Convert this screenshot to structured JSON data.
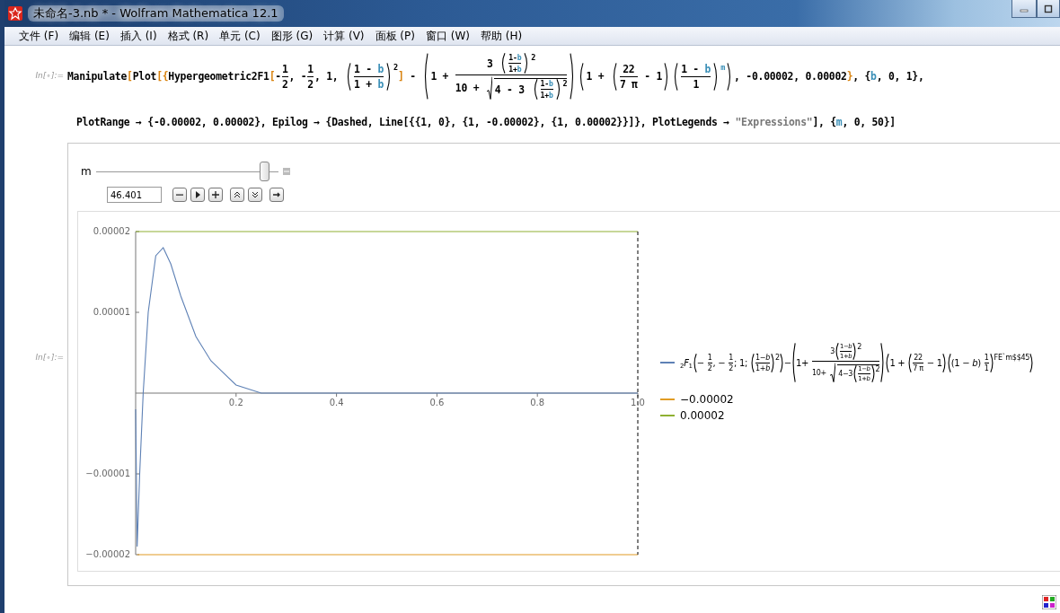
{
  "window": {
    "title": "未命名-3.nb * - Wolfram Mathematica 12.1"
  },
  "menu": [
    "文件 (F)",
    "编辑 (E)",
    "插入 (I)",
    "格式 (R)",
    "单元 (C)",
    "图形 (G)",
    "计算 (V)",
    "面板 (P)",
    "窗口 (W)",
    "帮助 (H)"
  ],
  "input_cell": {
    "label": "In[∘]:=",
    "lines": [
      [
        {
          "kind": "t",
          "text": "Manipulate"
        },
        {
          "kind": "br",
          "text": "["
        },
        {
          "kind": "t",
          "text": "Plot"
        },
        {
          "kind": "br",
          "text": "["
        },
        {
          "kind": "br",
          "text": "{"
        },
        {
          "kind": "t",
          "text": "Hypergeometric2F1"
        },
        {
          "kind": "br",
          "text": "["
        },
        {
          "kind": "t",
          "text": "-"
        },
        {
          "kind": "frac",
          "num": [
            {
              "kind": "t",
              "text": "1"
            }
          ],
          "den": [
            {
              "kind": "t",
              "text": "2"
            }
          ]
        },
        {
          "kind": "t",
          "text": ", -"
        },
        {
          "kind": "frac",
          "num": [
            {
              "kind": "t",
              "text": "1"
            }
          ],
          "den": [
            {
              "kind": "t",
              "text": "2"
            }
          ]
        },
        {
          "kind": "t",
          "text": ", 1, "
        },
        {
          "kind": "paren",
          "body": [
            {
              "kind": "frac",
              "num": [
                {
                  "kind": "t",
                  "text": "1 - "
                },
                {
                  "kind": "var",
                  "text": "b"
                }
              ],
              "den": [
                {
                  "kind": "t",
                  "text": "1 + "
                },
                {
                  "kind": "var",
                  "text": "b"
                }
              ]
            }
          ],
          "sup": [
            {
              "kind": "t",
              "text": "2"
            }
          ]
        },
        {
          "kind": "br",
          "text": "]"
        },
        {
          "kind": "t",
          "text": " - "
        },
        {
          "kind": "paren",
          "body": [
            {
              "kind": "t",
              "text": "1 + "
            },
            {
              "kind": "frac",
              "num": [
                {
                  "kind": "t",
                  "text": "3 "
                },
                {
                  "kind": "paren",
                  "body": [
                    {
                      "kind": "frac",
                      "num": [
                        {
                          "kind": "t",
                          "text": "1-"
                        },
                        {
                          "kind": "var",
                          "text": "b"
                        }
                      ],
                      "den": [
                        {
                          "kind": "t",
                          "text": "1+"
                        },
                        {
                          "kind": "var",
                          "text": "b"
                        }
                      ]
                    }
                  ],
                  "sup": [
                    {
                      "kind": "t",
                      "text": "2"
                    }
                  ]
                }
              ],
              "den": [
                {
                  "kind": "t",
                  "text": "10 + "
                },
                {
                  "kind": "sqrt",
                  "body": [
                    {
                      "kind": "t",
                      "text": "4 - 3 "
                    },
                    {
                      "kind": "paren",
                      "body": [
                        {
                          "kind": "frac",
                          "num": [
                            {
                              "kind": "t",
                              "text": "1-"
                            },
                            {
                              "kind": "var",
                              "text": "b"
                            }
                          ],
                          "den": [
                            {
                              "kind": "t",
                              "text": "1+"
                            },
                            {
                              "kind": "var",
                              "text": "b"
                            }
                          ]
                        }
                      ],
                      "sup": [
                        {
                          "kind": "t",
                          "text": "2"
                        }
                      ]
                    }
                  ]
                }
              ]
            }
          ]
        },
        {
          "kind": "paren",
          "body": [
            {
              "kind": "t",
              "text": "1 + "
            },
            {
              "kind": "paren",
              "body": [
                {
                  "kind": "frac",
                  "num": [
                    {
                      "kind": "t",
                      "text": "22"
                    }
                  ],
                  "den": [
                    {
                      "kind": "t",
                      "text": "7 π"
                    }
                  ]
                },
                {
                  "kind": "t",
                  "text": " - 1"
                }
              ]
            },
            {
              "kind": "paren",
              "body": [
                {
                  "kind": "frac",
                  "num": [
                    {
                      "kind": "t",
                      "text": "1 - "
                    },
                    {
                      "kind": "var",
                      "text": "b"
                    }
                  ],
                  "den": [
                    {
                      "kind": "t",
                      "text": "1"
                    }
                  ]
                }
              ],
              "sup": [
                {
                  "kind": "var",
                  "text": "m"
                }
              ]
            }
          ]
        },
        {
          "kind": "t",
          "text": ", -0.00002, 0.00002"
        },
        {
          "kind": "br",
          "text": "}"
        },
        {
          "kind": "t",
          "text": ", {"
        },
        {
          "kind": "var",
          "text": "b"
        },
        {
          "kind": "t",
          "text": ", 0, 1},"
        }
      ],
      [
        {
          "kind": "t",
          "text": "PlotRange → {-0.00002, 0.00002}, Epilog → {Dashed, Line[{{1, 0}, {1, -0.00002}, {1, 0.00002}}]}, PlotLegends → "
        },
        {
          "kind": "str",
          "text": "\"Expressions\""
        },
        {
          "kind": "t",
          "text": "], {"
        },
        {
          "kind": "var",
          "text": "m"
        },
        {
          "kind": "t",
          "text": ", 0, 50}]"
        }
      ]
    ]
  },
  "output_cell": {
    "label": "In[∘]:=",
    "control": {
      "label": "m",
      "level": 0.928,
      "value": "46.401"
    },
    "chart_data": {
      "type": "line",
      "x": [
        0,
        0.003,
        0.008,
        0.015,
        0.025,
        0.04,
        0.055,
        0.07,
        0.09,
        0.12,
        0.15,
        0.2,
        0.25,
        0.3,
        0.4,
        0.6,
        0.8,
        1.0
      ],
      "series": [
        {
          "color": "#5e81b5",
          "values": [
            -2e-06,
            -1.9e-05,
            -1e-05,
            0,
            1e-05,
            1.7e-05,
            1.8e-05,
            1.6e-05,
            1.2e-05,
            7e-06,
            4e-06,
            1e-06,
            0,
            0,
            0,
            0,
            0,
            0
          ]
        },
        {
          "color": "#e19c24",
          "values": [
            null,
            -2e-05,
            -2e-05,
            -2e-05,
            -2e-05,
            -2e-05,
            -2e-05,
            -2e-05,
            -2e-05,
            -2e-05,
            -2e-05,
            -2e-05,
            -2e-05,
            -2e-05,
            -2e-05,
            -2e-05,
            -2e-05,
            -2e-05
          ]
        },
        {
          "color": "#8fb032",
          "values": [
            2e-05,
            2e-05,
            2e-05,
            2e-05,
            2e-05,
            2e-05,
            2e-05,
            2e-05,
            2e-05,
            2e-05,
            2e-05,
            2e-05,
            2e-05,
            2e-05,
            2e-05,
            2e-05,
            2e-05,
            2e-05
          ]
        }
      ],
      "xlim": [
        0,
        1
      ],
      "ylim": [
        -2e-05,
        2e-05
      ],
      "xticks": [
        {
          "value": 0.2,
          "label": "0.2"
        },
        {
          "value": 0.4,
          "label": "0.4"
        },
        {
          "value": 0.6,
          "label": "0.6"
        },
        {
          "value": 0.8,
          "label": "0.8"
        },
        {
          "value": 1,
          "label": "1.0"
        }
      ],
      "yticks": [
        {
          "value": 2e-05,
          "label": "0.00002"
        },
        {
          "value": 1e-05,
          "label": "0.00001"
        },
        {
          "value": -1e-05,
          "label": "−0.00001"
        },
        {
          "value": -2e-05,
          "label": "−0.00002"
        }
      ]
    },
    "legend": [
      {
        "kind": "formula",
        "tokens": [
          {
            "kind": "sub",
            "text": "2"
          },
          {
            "kind": "it",
            "text": "F"
          },
          {
            "kind": "sub",
            "text": "1"
          },
          {
            "kind": "paren",
            "body": [
              {
                "kind": "t",
                "text": "− "
              },
              {
                "kind": "frac",
                "num": [
                  {
                    "kind": "t",
                    "text": "1"
                  }
                ],
                "den": [
                  {
                    "kind": "t",
                    "text": "2"
                  }
                ]
              },
              {
                "kind": "t",
                "text": ", − "
              },
              {
                "kind": "frac",
                "num": [
                  {
                    "kind": "t",
                    "text": "1"
                  }
                ],
                "den": [
                  {
                    "kind": "t",
                    "text": "2"
                  }
                ]
              },
              {
                "kind": "t",
                "text": "; 1; "
              },
              {
                "kind": "paren",
                "body": [
                  {
                    "kind": "frac",
                    "num": [
                      {
                        "kind": "t",
                        "text": "1−"
                      },
                      {
                        "kind": "it",
                        "text": "b"
                      }
                    ],
                    "den": [
                      {
                        "kind": "t",
                        "text": "1+"
                      },
                      {
                        "kind": "it",
                        "text": "b"
                      }
                    ]
                  }
                ],
                "sup": [
                  {
                    "kind": "t",
                    "text": "2"
                  }
                ]
              }
            ]
          },
          {
            "kind": "t",
            "text": "−"
          },
          {
            "kind": "paren",
            "body": [
              {
                "kind": "t",
                "text": "1+ "
              },
              {
                "kind": "frac",
                "num": [
                  {
                    "kind": "t",
                    "text": "3"
                  },
                  {
                    "kind": "paren",
                    "body": [
                      {
                        "kind": "frac",
                        "num": [
                          {
                            "kind": "t",
                            "text": "1−"
                          },
                          {
                            "kind": "it",
                            "text": "b"
                          }
                        ],
                        "den": [
                          {
                            "kind": "t",
                            "text": "1+"
                          },
                          {
                            "kind": "it",
                            "text": "b"
                          }
                        ]
                      }
                    ],
                    "sup": [
                      {
                        "kind": "t",
                        "text": "2"
                      }
                    ]
                  }
                ],
                "den": [
                  {
                    "kind": "t",
                    "text": "10+ "
                  },
                  {
                    "kind": "sqrt",
                    "body": [
                      {
                        "kind": "t",
                        "text": "4−3"
                      },
                      {
                        "kind": "paren",
                        "body": [
                          {
                            "kind": "frac",
                            "num": [
                              {
                                "kind": "t",
                                "text": "1−"
                              },
                              {
                                "kind": "it",
                                "text": "b"
                              }
                            ],
                            "den": [
                              {
                                "kind": "t",
                                "text": "1+"
                              },
                              {
                                "kind": "it",
                                "text": "b"
                              }
                            ]
                          }
                        ],
                        "sup": [
                          {
                            "kind": "t",
                            "text": "2"
                          }
                        ]
                      }
                    ]
                  }
                ]
              }
            ]
          },
          {
            "kind": "paren",
            "body": [
              {
                "kind": "t",
                "text": "1 + "
              },
              {
                "kind": "paren",
                "body": [
                  {
                    "kind": "frac",
                    "num": [
                      {
                        "kind": "t",
                        "text": "22"
                      }
                    ],
                    "den": [
                      {
                        "kind": "t",
                        "text": "7 π"
                      }
                    ]
                  },
                  {
                    "kind": "t",
                    "text": " − 1"
                  }
                ]
              },
              {
                "kind": "paren",
                "body": [
                  {
                    "kind": "t",
                    "text": "(1 − "
                  },
                  {
                    "kind": "it",
                    "text": "b"
                  },
                  {
                    "kind": "t",
                    "text": ") "
                  },
                  {
                    "kind": "frac",
                    "num": [
                      {
                        "kind": "t",
                        "text": "1"
                      }
                    ],
                    "den": [
                      {
                        "kind": "t",
                        "text": "1"
                      }
                    ]
                  }
                ],
                "sup": [
                  {
                    "kind": "t",
                    "text": "FE`m$$45"
                  }
                ]
              }
            ]
          }
        ]
      },
      {
        "kind": "text",
        "text": "−0.00002"
      },
      {
        "kind": "text",
        "text": "0.00002"
      }
    ]
  }
}
